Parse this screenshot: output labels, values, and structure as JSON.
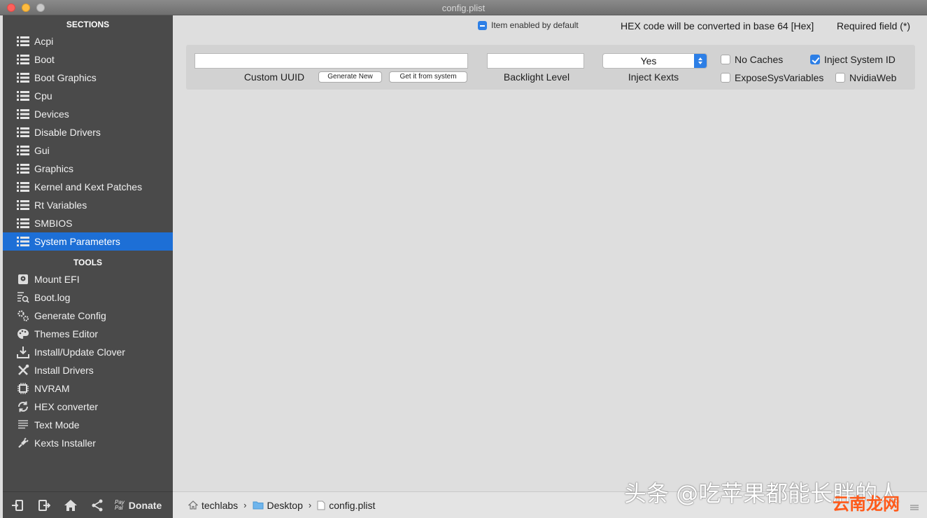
{
  "window": {
    "title": "config.plist"
  },
  "sidebar": {
    "sections_header": "SECTIONS",
    "sections": [
      {
        "label": "Acpi",
        "icon": "list-icon"
      },
      {
        "label": "Boot",
        "icon": "list-icon"
      },
      {
        "label": "Boot Graphics",
        "icon": "list-icon"
      },
      {
        "label": "Cpu",
        "icon": "list-icon"
      },
      {
        "label": "Devices",
        "icon": "list-icon"
      },
      {
        "label": "Disable Drivers",
        "icon": "list-icon"
      },
      {
        "label": "Gui",
        "icon": "list-icon"
      },
      {
        "label": "Graphics",
        "icon": "list-icon"
      },
      {
        "label": "Kernel and Kext Patches",
        "icon": "list-icon"
      },
      {
        "label": "Rt Variables",
        "icon": "list-icon"
      },
      {
        "label": "SMBIOS",
        "icon": "list-icon"
      },
      {
        "label": "System Parameters",
        "icon": "list-icon",
        "selected": true
      }
    ],
    "tools_header": "TOOLS",
    "tools": [
      {
        "label": "Mount EFI",
        "icon": "disk-icon"
      },
      {
        "label": "Boot.log",
        "icon": "log-search-icon"
      },
      {
        "label": "Generate Config",
        "icon": "gears-icon"
      },
      {
        "label": "Themes Editor",
        "icon": "palette-icon"
      },
      {
        "label": "Install/Update Clover",
        "icon": "download-icon"
      },
      {
        "label": "Install Drivers",
        "icon": "tools-icon"
      },
      {
        "label": "NVRAM",
        "icon": "chip-icon"
      },
      {
        "label": "HEX converter",
        "icon": "refresh-icon"
      },
      {
        "label": "Text Mode",
        "icon": "text-lines-icon"
      },
      {
        "label": "Kexts Installer",
        "icon": "plug-icon"
      }
    ],
    "bottom": {
      "paypal_line1": "Pay",
      "paypal_line2": "Pal",
      "donate_label": "Donate"
    }
  },
  "header": {
    "legend_label": "Item enabled by default",
    "hex_note": "HEX code will be converted in base 64 [Hex]",
    "required_note": "Required field (*)"
  },
  "form": {
    "custom_uuid": {
      "label": "Custom UUID",
      "value": ""
    },
    "generate_new_label": "Generate New",
    "get_from_system_label": "Get it from system",
    "backlight_level": {
      "label": "Backlight Level",
      "value": ""
    },
    "inject_kexts": {
      "label": "Inject Kexts",
      "selected": "Yes"
    },
    "checkboxes": {
      "no_caches": {
        "label": "No Caches",
        "checked": false
      },
      "inject_system_id": {
        "label": "Inject System ID",
        "checked": true
      },
      "expose_sys_variables": {
        "label": "ExposeSysVariables",
        "checked": false
      },
      "nvidia_web": {
        "label": "NvidiaWeb",
        "checked": false
      }
    }
  },
  "pathbar": {
    "crumbs": [
      "techlabs",
      "Desktop",
      "config.plist"
    ],
    "separator": "›"
  },
  "watermark": {
    "text": "头条 @吃苹果都能长胖的人",
    "logo_text": "云南龙网"
  },
  "colors": {
    "accent": "#1d6fd6",
    "sidebar_bg": "#4a4a4a",
    "panel_bg": "#dedede"
  }
}
